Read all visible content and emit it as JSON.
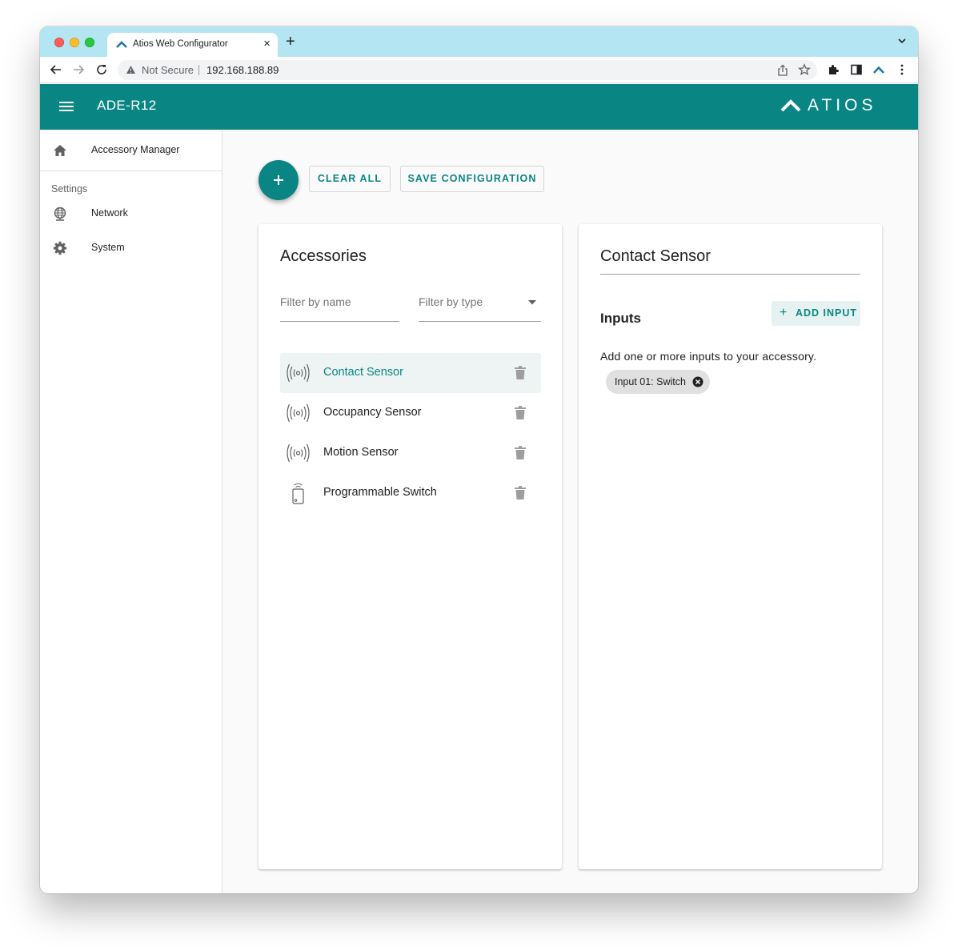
{
  "browser": {
    "tab_title": "Atios Web Configurator",
    "tab_close": "×",
    "new_tab": "+",
    "security_label": "Not Secure",
    "url": "192.168.188.89",
    "theme_color": "#b3e5f2"
  },
  "app": {
    "device_name": "ADE-R12",
    "brand": "ATIOS",
    "primary_color": "#098583"
  },
  "sidebar": {
    "items": [
      {
        "label": "Accessory Manager",
        "icon": "home-icon"
      }
    ],
    "settings_header": "Settings",
    "settings_items": [
      {
        "label": "Network",
        "icon": "globe-icon"
      },
      {
        "label": "System",
        "icon": "gear-icon"
      }
    ]
  },
  "actions": {
    "add_icon": "+",
    "clear_all": "CLEAR ALL",
    "save_configuration": "SAVE CONFIGURATION"
  },
  "accessories": {
    "title": "Accessories",
    "filter_name_placeholder": "Filter by name",
    "filter_type_placeholder": "Filter by type",
    "items": [
      {
        "name": "Contact Sensor",
        "icon": "sensor-waves-icon",
        "selected": true
      },
      {
        "name": "Occupancy Sensor",
        "icon": "sensor-waves-icon",
        "selected": false
      },
      {
        "name": "Motion Sensor",
        "icon": "sensor-waves-icon",
        "selected": false
      },
      {
        "name": "Programmable Switch",
        "icon": "switch-icon",
        "selected": false
      }
    ]
  },
  "detail": {
    "title": "Contact Sensor",
    "inputs_heading": "Inputs",
    "add_input_icon": "+",
    "add_input": "ADD INPUT",
    "inputs_description": "Add one or more inputs to your accessory.",
    "inputs": [
      {
        "label": "Input 01: Switch"
      }
    ]
  }
}
